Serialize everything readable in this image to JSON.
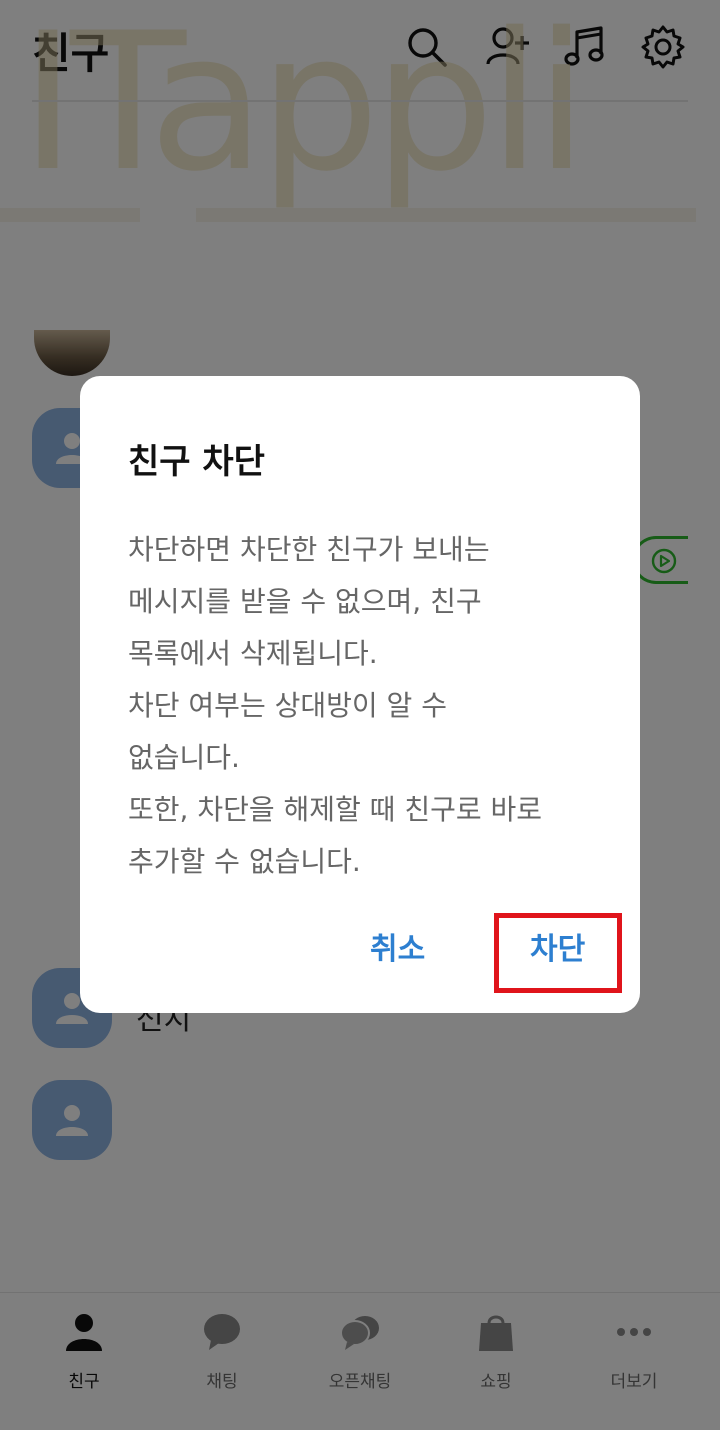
{
  "header": {
    "title": "친구",
    "icons": [
      "search-icon",
      "add-friend-icon",
      "music-icon",
      "settings-icon"
    ]
  },
  "watermark": "ITappli",
  "friend_list": {
    "visible_name": "선지"
  },
  "dialog": {
    "title": "친구 차단",
    "body_lines": [
      "차단하면 차단한 친구가 보내는",
      "메시지를 받을 수 없으며, 친구",
      "목록에서 삭제됩니다.",
      "차단 여부는 상대방이 알 수",
      "없습니다.",
      "또한, 차단을 해제할 때 친구로 바로",
      "추가할 수 없습니다."
    ],
    "cancel_label": "취소",
    "confirm_label": "차단"
  },
  "bottom_nav": {
    "items": [
      {
        "label": "친구",
        "icon": "person-icon",
        "active": true
      },
      {
        "label": "채팅",
        "icon": "chat-bubble-icon",
        "active": false
      },
      {
        "label": "오픈채팅",
        "icon": "open-chat-icon",
        "active": false
      },
      {
        "label": "쇼핑",
        "icon": "shopping-bag-icon",
        "active": false
      },
      {
        "label": "더보기",
        "icon": "more-dots-icon",
        "active": false
      }
    ]
  },
  "colors": {
    "accent_blue": "#2d7fd0",
    "highlight_red": "#e0141b",
    "avatar_blue": "#8fb4e3",
    "play_green": "#2eb82e"
  }
}
